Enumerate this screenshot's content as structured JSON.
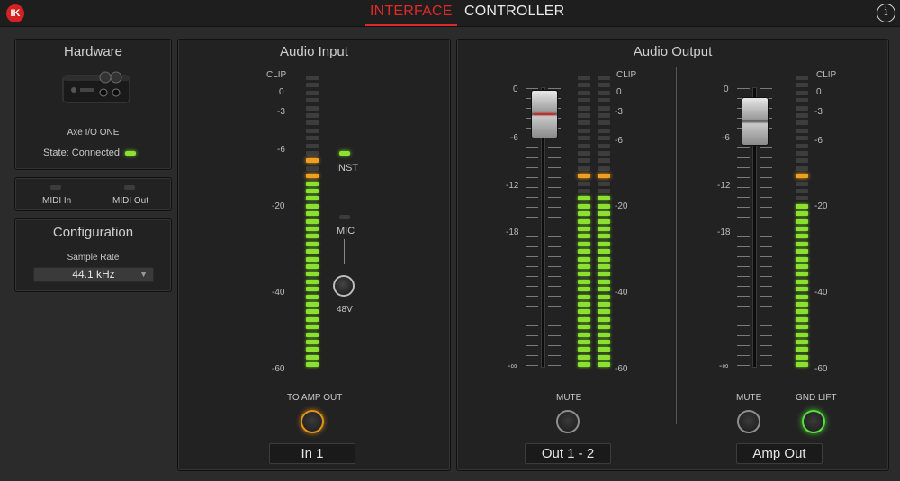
{
  "topbar": {
    "logo": "IK",
    "tabs": [
      {
        "label": "INTERFACE",
        "active": true
      },
      {
        "label": "CONTROLLER",
        "active": false
      }
    ],
    "info_icon": "info-icon",
    "info_glyph": "i"
  },
  "colors": {
    "accent": "#e02a2a",
    "led_green": "#8be030",
    "led_orange": "#f0a020"
  },
  "hardware": {
    "title": "Hardware",
    "device_name": "Axe I/O ONE",
    "state_label": "State: Connected"
  },
  "midi": {
    "in_label": "MIDI In",
    "out_label": "MIDI Out"
  },
  "configuration": {
    "title": "Configuration",
    "sample_rate_label": "Sample Rate",
    "sample_rate_value": "44.1 kHz"
  },
  "audio_input": {
    "title": "Audio Input",
    "scale": [
      "CLIP",
      "0",
      "-3",
      "-6",
      "-20",
      "-40",
      "-60"
    ],
    "inst_label": "INST",
    "mic_label": "MIC",
    "phantom_label": "48V",
    "to_amp_label": "TO AMP OUT",
    "channel_name": "In 1"
  },
  "audio_output": {
    "title": "Audio Output",
    "fader_scale": [
      "0",
      "-6",
      "-12",
      "-18",
      "-∞"
    ],
    "meter_scale": [
      "CLIP",
      "0",
      "-3",
      "-6",
      "-20",
      "-40",
      "-60"
    ],
    "out12": {
      "mute_label": "MUTE",
      "channel_name": "Out 1 - 2"
    },
    "amp": {
      "mute_label": "MUTE",
      "gnd_lift_label": "GND LIFT",
      "channel_name": "Amp Out"
    }
  }
}
